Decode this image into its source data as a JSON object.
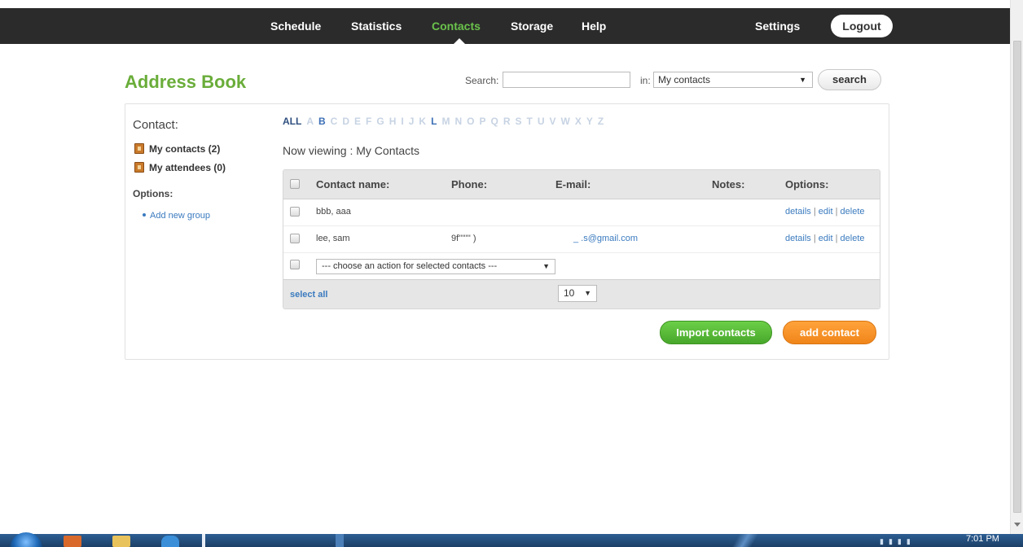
{
  "nav": {
    "items": [
      "Schedule",
      "Statistics",
      "Contacts",
      "Storage",
      "Help"
    ],
    "active": "Contacts",
    "settings": "Settings",
    "logout": "Logout"
  },
  "header": {
    "title": "Address Book",
    "search_label": "Search:",
    "search_value": "",
    "in_label": "in:",
    "scope_value": "My contacts",
    "search_button": "search"
  },
  "sidebar": {
    "heading": "Contact:",
    "groups": [
      {
        "label": "My contacts (2)",
        "icon": "address-book-icon"
      },
      {
        "label": "My attendees (0)",
        "icon": "address-book-icon"
      }
    ],
    "options_heading": "Options:",
    "add_group": "Add new group"
  },
  "alphabet": {
    "letters": [
      "ALL",
      "A",
      "B",
      "C",
      "D",
      "E",
      "F",
      "G",
      "H",
      "I",
      "J",
      "K",
      "L",
      "M",
      "N",
      "O",
      "P",
      "Q",
      "R",
      "S",
      "T",
      "U",
      "V",
      "W",
      "X",
      "Y",
      "Z"
    ],
    "selected": "ALL",
    "with_contacts": [
      "B",
      "L"
    ]
  },
  "viewing": "Now viewing : My Contacts",
  "table": {
    "headers": {
      "name": "Contact name:",
      "phone": "Phone:",
      "email": "E-mail:",
      "notes": "Notes:",
      "options": "Options:"
    },
    "rows": [
      {
        "name": "bbb, aaa",
        "phone": "",
        "email": "",
        "notes": ""
      },
      {
        "name": "lee, sam",
        "phone": "9f''''''' )",
        "email": "_ .s@gmail.com",
        "notes": ""
      }
    ],
    "row_options": {
      "details": "details",
      "edit": "edit",
      "delete": "delete",
      "sep": "|"
    },
    "bulk_action": "--- choose an action for selected contacts ---",
    "select_all": "select all",
    "per_page": "10"
  },
  "buttons": {
    "import": "Import contacts",
    "add": "add contact"
  },
  "taskbar": {
    "clock": "7:01 PM"
  },
  "colors": {
    "nav_bg": "#2b2b2b",
    "nav_active": "#6ac24b",
    "title_green": "#6aad3a",
    "link_blue": "#3b7bbf",
    "import_green": "#48a72b",
    "add_orange": "#f0851a"
  }
}
